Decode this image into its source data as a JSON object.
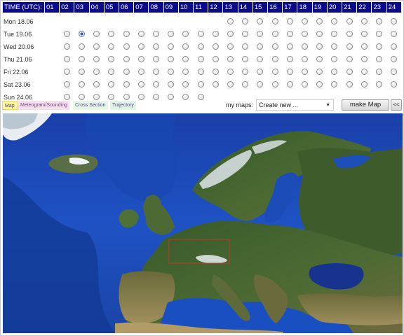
{
  "grid": {
    "time_label": "TIME (UTC):",
    "hours": [
      "01",
      "02",
      "03",
      "04",
      "05",
      "06",
      "07",
      "08",
      "09",
      "10",
      "11",
      "12",
      "13",
      "14",
      "15",
      "16",
      "17",
      "18",
      "19",
      "20",
      "21",
      "22",
      "23",
      "24"
    ],
    "days": [
      {
        "label": "Mon 18.06",
        "first_hour": 13,
        "last_hour": 24,
        "selected_hour": null
      },
      {
        "label": "Tue 19.06",
        "first_hour": 2,
        "last_hour": 24,
        "selected_hour": 3
      },
      {
        "label": "Wed 20.06",
        "first_hour": 2,
        "last_hour": 24,
        "selected_hour": null
      },
      {
        "label": "Thu 21.06",
        "first_hour": 2,
        "last_hour": 24,
        "selected_hour": null
      },
      {
        "label": "Fri 22.06",
        "first_hour": 2,
        "last_hour": 24,
        "selected_hour": null
      },
      {
        "label": "Sat 23.06",
        "first_hour": 2,
        "last_hour": 24,
        "selected_hour": null
      },
      {
        "label": "Sun 24.06",
        "first_hour": 2,
        "last_hour": 11,
        "selected_hour": null
      }
    ]
  },
  "toolbar": {
    "tabs": {
      "map": "Map",
      "meteogram": "Meteogram/Sounding",
      "cross_section": "Cross Section",
      "trajectory": "Trajectory"
    },
    "my_maps_label": "my maps:",
    "my_maps_selected": "Create new ...",
    "make_map_label": "make Map",
    "collapse_label": "<<"
  },
  "colors": {
    "header_bg": "#0a0a8c",
    "ocean": "#1d4bb0",
    "land": "#3c5a2a",
    "selection_box": "#c0392b"
  }
}
